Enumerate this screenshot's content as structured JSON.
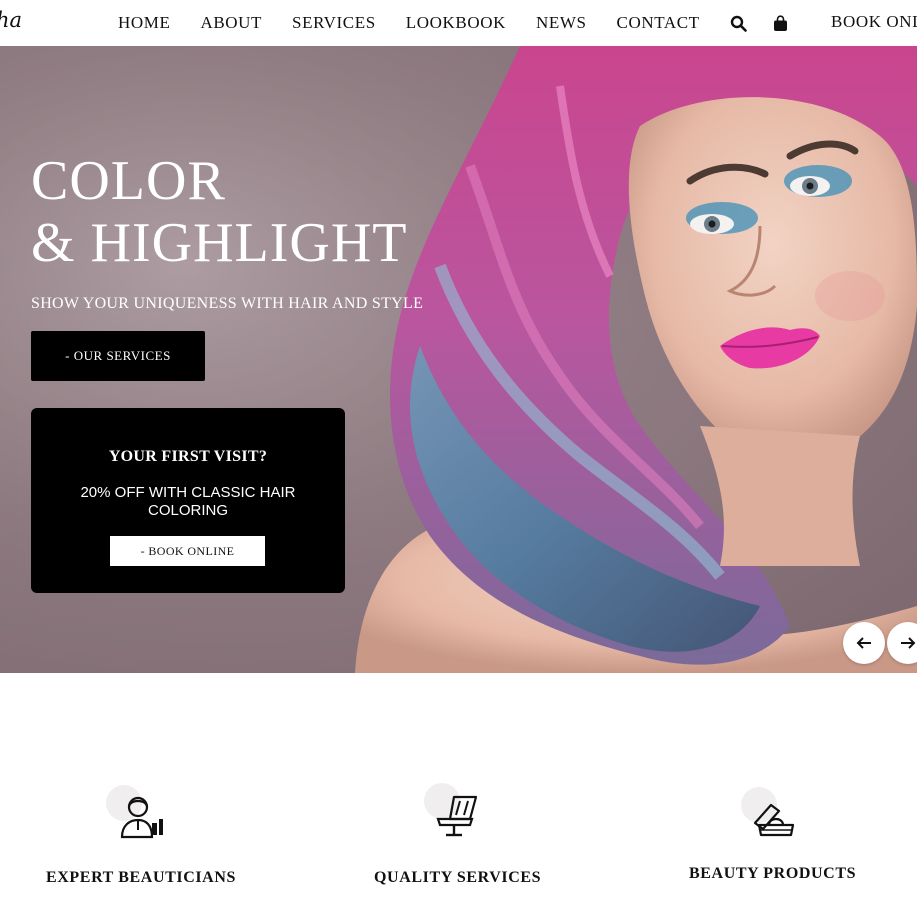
{
  "header": {
    "logo_text": "ha",
    "nav": [
      "HOME",
      "ABOUT",
      "SERVICES",
      "LOOKBOOK",
      "NEWS",
      "CONTACT"
    ],
    "search_icon": "search-icon",
    "bag_icon": "shopping-bag-icon",
    "book_label": "BOOK ONLINE"
  },
  "hero": {
    "title_line1": "COLOR",
    "title_line2": "& HIGHLIGHT",
    "subtitle": "SHOW YOUR UNIQUENESS WITH HAIR AND STYLE",
    "services_button": "- OUR SERVICES",
    "visit_card": {
      "title": "YOUR FIRST VISIT?",
      "offer": "20% OFF WITH CLASSIC HAIR COLORING",
      "button": "- BOOK ONLINE"
    },
    "prev_icon": "arrow-left-icon",
    "next_icon": "arrow-right-icon"
  },
  "features": [
    {
      "icon": "beautician-icon",
      "title": "EXPERT BEAUTICIANS"
    },
    {
      "icon": "salon-chair-icon",
      "title": "QUALITY SERVICES"
    },
    {
      "icon": "beauty-products-icon",
      "title": "BEAUTY PRODUCTS"
    }
  ],
  "colors": {
    "accent": "#000000",
    "hero_bg": "#8e7b81",
    "text": "#111111"
  }
}
